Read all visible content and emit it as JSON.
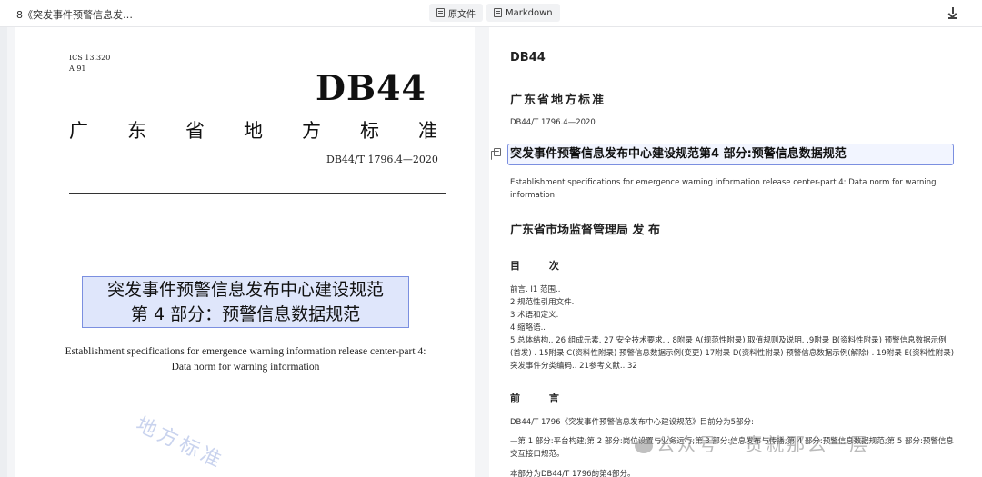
{
  "topbar": {
    "doc_title": "8《突发事件预警信息发…",
    "tab_original": "原文件",
    "tab_markdown": "Markdown"
  },
  "left_page": {
    "ics": "ICS 13.320",
    "classification": "A 91",
    "db44": "DB44",
    "gd_standard_chars": [
      "广",
      "东",
      "省",
      "地",
      "方",
      "标",
      "准"
    ],
    "standard_number": "DB44/T 1796.4—2020",
    "title_line1": "突发事件预警信息发布中心建设规范",
    "title_line2": "第 4 部分：预警信息数据规范",
    "english_title": "Establishment specifications for emergence warning information release center-part 4: Data norm for warning information",
    "watermark": "地方标准"
  },
  "right_page": {
    "db44": "DB44",
    "gd_standard": "广东省地方标准",
    "standard_number": "DB44/T 1796.4—2020",
    "title": "突发事件预警信息发布中心建设规范第4 部分:预警信息数据规范",
    "english_title": "Establishment specifications for emergence warning information release center-part 4: Data norm for warning information",
    "issuer": "广东省市场监督管理局 发 布",
    "toc_heading": "目 次",
    "toc": [
      "前言. I1 范围..",
      "2 规范性引用文件.",
      "3 术语和定义.",
      "4 缩略语..",
      "5 总体结构.. 26 组成元素. 27 安全技术要求. . 8附录 A(规范性附录) 取值规则及说明. .9附录 B(资料性附录) 预警信息数据示例(首发) . 15附录 C(资料性附录) 预警信息数据示例(变更) 17附录 D(资料性附录) 预警信息数据示例(解除) . 19附录 E(资料性附录) 突发事件分类编码.. 21参考文献.. 32"
    ],
    "preface_heading": "前 言",
    "preface_p1": "DB44/T 1796《突发事件预警信息发布中心建设规范》目前分为5部分:",
    "preface_p2": "—第 1 部分:平台构建;第 2 部分:岗位设置与业务运行;第 3 部分:信息发布与传播;第 4 部分:预警信息数据规范;第 5 部分:预警信息交互接口规范。",
    "preface_p3": "本部分为DB44/T 1796的第4部分。",
    "watermark": "公众号 · 责就那么一层"
  }
}
